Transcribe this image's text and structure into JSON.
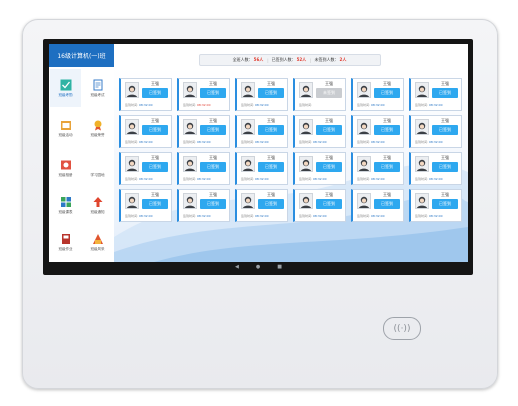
{
  "header": {
    "class_title": "16级计算机(一)班",
    "stats": {
      "should_label": "全班人数：",
      "should_count": "56人",
      "arrived_label": "已签到人数：",
      "arrived_count": "52人",
      "absent_label": "未签到人数：",
      "absent_count": "2人"
    }
  },
  "sidebar": {
    "items": [
      {
        "label": "班级考勤",
        "icon": "check-icon",
        "active": true
      },
      {
        "label": "班级考试",
        "icon": "exam-icon",
        "active": false
      },
      {
        "label": "班级活动",
        "icon": "activity-icon",
        "active": false
      },
      {
        "label": "班级荣誉",
        "icon": "medal-icon",
        "active": false
      },
      {
        "label": "班级相册",
        "icon": "album-icon",
        "active": false
      },
      {
        "label": "学习园地",
        "icon": "blank-icon",
        "active": false
      },
      {
        "label": "班级课表",
        "icon": "schedule-icon",
        "active": false
      },
      {
        "label": "班级通知",
        "icon": "notice-icon",
        "active": false
      },
      {
        "label": "班级作业",
        "icon": "homework-icon",
        "active": false
      },
      {
        "label": "班级风采",
        "icon": "style-icon",
        "active": false
      }
    ]
  },
  "students": [
    {
      "name": "王强",
      "status": "已签到",
      "signed": true,
      "time_label": "签到时间:",
      "time": "08:32:00",
      "late": false
    },
    {
      "name": "王强",
      "status": "已签到",
      "signed": true,
      "time_label": "签到时间:",
      "time": "08:32:00",
      "late": true
    },
    {
      "name": "王强",
      "status": "已签到",
      "signed": true,
      "time_label": "签到时间:",
      "time": "08:32:00",
      "late": false
    },
    {
      "name": "王强",
      "status": "未签到",
      "signed": false,
      "time_label": "签到时间:",
      "time": "",
      "late": false
    },
    {
      "name": "王强",
      "status": "已签到",
      "signed": true,
      "time_label": "签到时间:",
      "time": "08:32:00",
      "late": false
    },
    {
      "name": "王强",
      "status": "已签到",
      "signed": true,
      "time_label": "签到时间:",
      "time": "08:32:00",
      "late": false
    },
    {
      "name": "王强",
      "status": "已签到",
      "signed": true,
      "time_label": "签到时间:",
      "time": "08:32:00",
      "late": false
    },
    {
      "name": "王强",
      "status": "已签到",
      "signed": true,
      "time_label": "签到时间:",
      "time": "08:32:00",
      "late": false
    },
    {
      "name": "王强",
      "status": "已签到",
      "signed": true,
      "time_label": "签到时间:",
      "time": "08:32:00",
      "late": false
    },
    {
      "name": "王强",
      "status": "已签到",
      "signed": true,
      "time_label": "签到时间:",
      "time": "08:32:00",
      "late": false
    },
    {
      "name": "王强",
      "status": "已签到",
      "signed": true,
      "time_label": "签到时间:",
      "time": "08:32:00",
      "late": false
    },
    {
      "name": "王强",
      "status": "已签到",
      "signed": true,
      "time_label": "签到时间:",
      "time": "08:32:00",
      "late": false
    },
    {
      "name": "王强",
      "status": "已签到",
      "signed": true,
      "time_label": "签到时间:",
      "time": "08:32:00",
      "late": false
    },
    {
      "name": "王强",
      "status": "已签到",
      "signed": true,
      "time_label": "签到时间:",
      "time": "08:32:00",
      "late": false
    },
    {
      "name": "王强",
      "status": "已签到",
      "signed": true,
      "time_label": "签到时间:",
      "time": "08:32:00",
      "late": false
    },
    {
      "name": "王强",
      "status": "已签到",
      "signed": true,
      "time_label": "签到时间:",
      "time": "08:32:00",
      "late": false
    },
    {
      "name": "王强",
      "status": "已签到",
      "signed": true,
      "time_label": "签到时间:",
      "time": "08:32:00",
      "late": false
    },
    {
      "name": "王强",
      "status": "已签到",
      "signed": true,
      "time_label": "签到时间:",
      "time": "08:32:00",
      "late": false
    },
    {
      "name": "王强",
      "status": "已签到",
      "signed": true,
      "time_label": "签到时间:",
      "time": "08:32:00",
      "late": false
    },
    {
      "name": "王强",
      "status": "已签到",
      "signed": true,
      "time_label": "签到时间:",
      "time": "08:32:00",
      "late": false
    },
    {
      "name": "王强",
      "status": "已签到",
      "signed": true,
      "time_label": "签到时间:",
      "time": "08:32:00",
      "late": false
    },
    {
      "name": "王强",
      "status": "已签到",
      "signed": true,
      "time_label": "签到时间:",
      "time": "08:32:00",
      "late": false
    },
    {
      "name": "王强",
      "status": "已签到",
      "signed": true,
      "time_label": "签到时间:",
      "time": "08:32:00",
      "late": false
    },
    {
      "name": "王强",
      "status": "已签到",
      "signed": true,
      "time_label": "签到时间:",
      "time": "08:32:00",
      "late": false
    }
  ],
  "android_nav": {
    "back": "◀",
    "home": "●",
    "recent": "■"
  },
  "nfc_symbol": "((·))",
  "colors": {
    "accent": "#1e6fc1",
    "badge": "#2ea8ef",
    "badge_off": "#c9ccd0",
    "alert": "#e03a2e"
  }
}
